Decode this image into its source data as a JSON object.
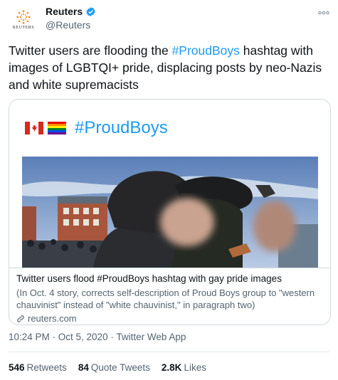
{
  "author": {
    "name": "Reuters",
    "handle": "@Reuters",
    "brand": "REUTERS",
    "verified_color": "#1d9bf0"
  },
  "tweet": {
    "text_before": "Twitter users are flooding the ",
    "hashtag": "#ProudBoys",
    "text_after": " hashtag with images of LGBTQI+ pride, displacing posts by neo-Nazis and white supremacists"
  },
  "card": {
    "hero_hashtag": "#ProudBoys",
    "flags": [
      "canada-flag-icon",
      "rainbow-flag-icon"
    ],
    "title": "Twitter users flood #ProudBoys hashtag with gay pride images",
    "description": "(In Oct. 4 story, corrects self-description of Proud Boys group to \"western chauvinist\" instead of \"white chauvinist,\" in paragraph two)",
    "domain": "reuters.com"
  },
  "meta": {
    "timestamp": "10:24 PM · Oct 5, 2020 · Twitter Web App"
  },
  "stats": {
    "retweets_num": "546",
    "retweets_label": "Retweets",
    "quotes_num": "84",
    "quotes_label": "Quote Tweets",
    "likes_num": "2.8K",
    "likes_label": "Likes"
  },
  "colors": {
    "link": "#1d9bf0",
    "secondary_text": "#536471",
    "border": "#cfd9de"
  }
}
